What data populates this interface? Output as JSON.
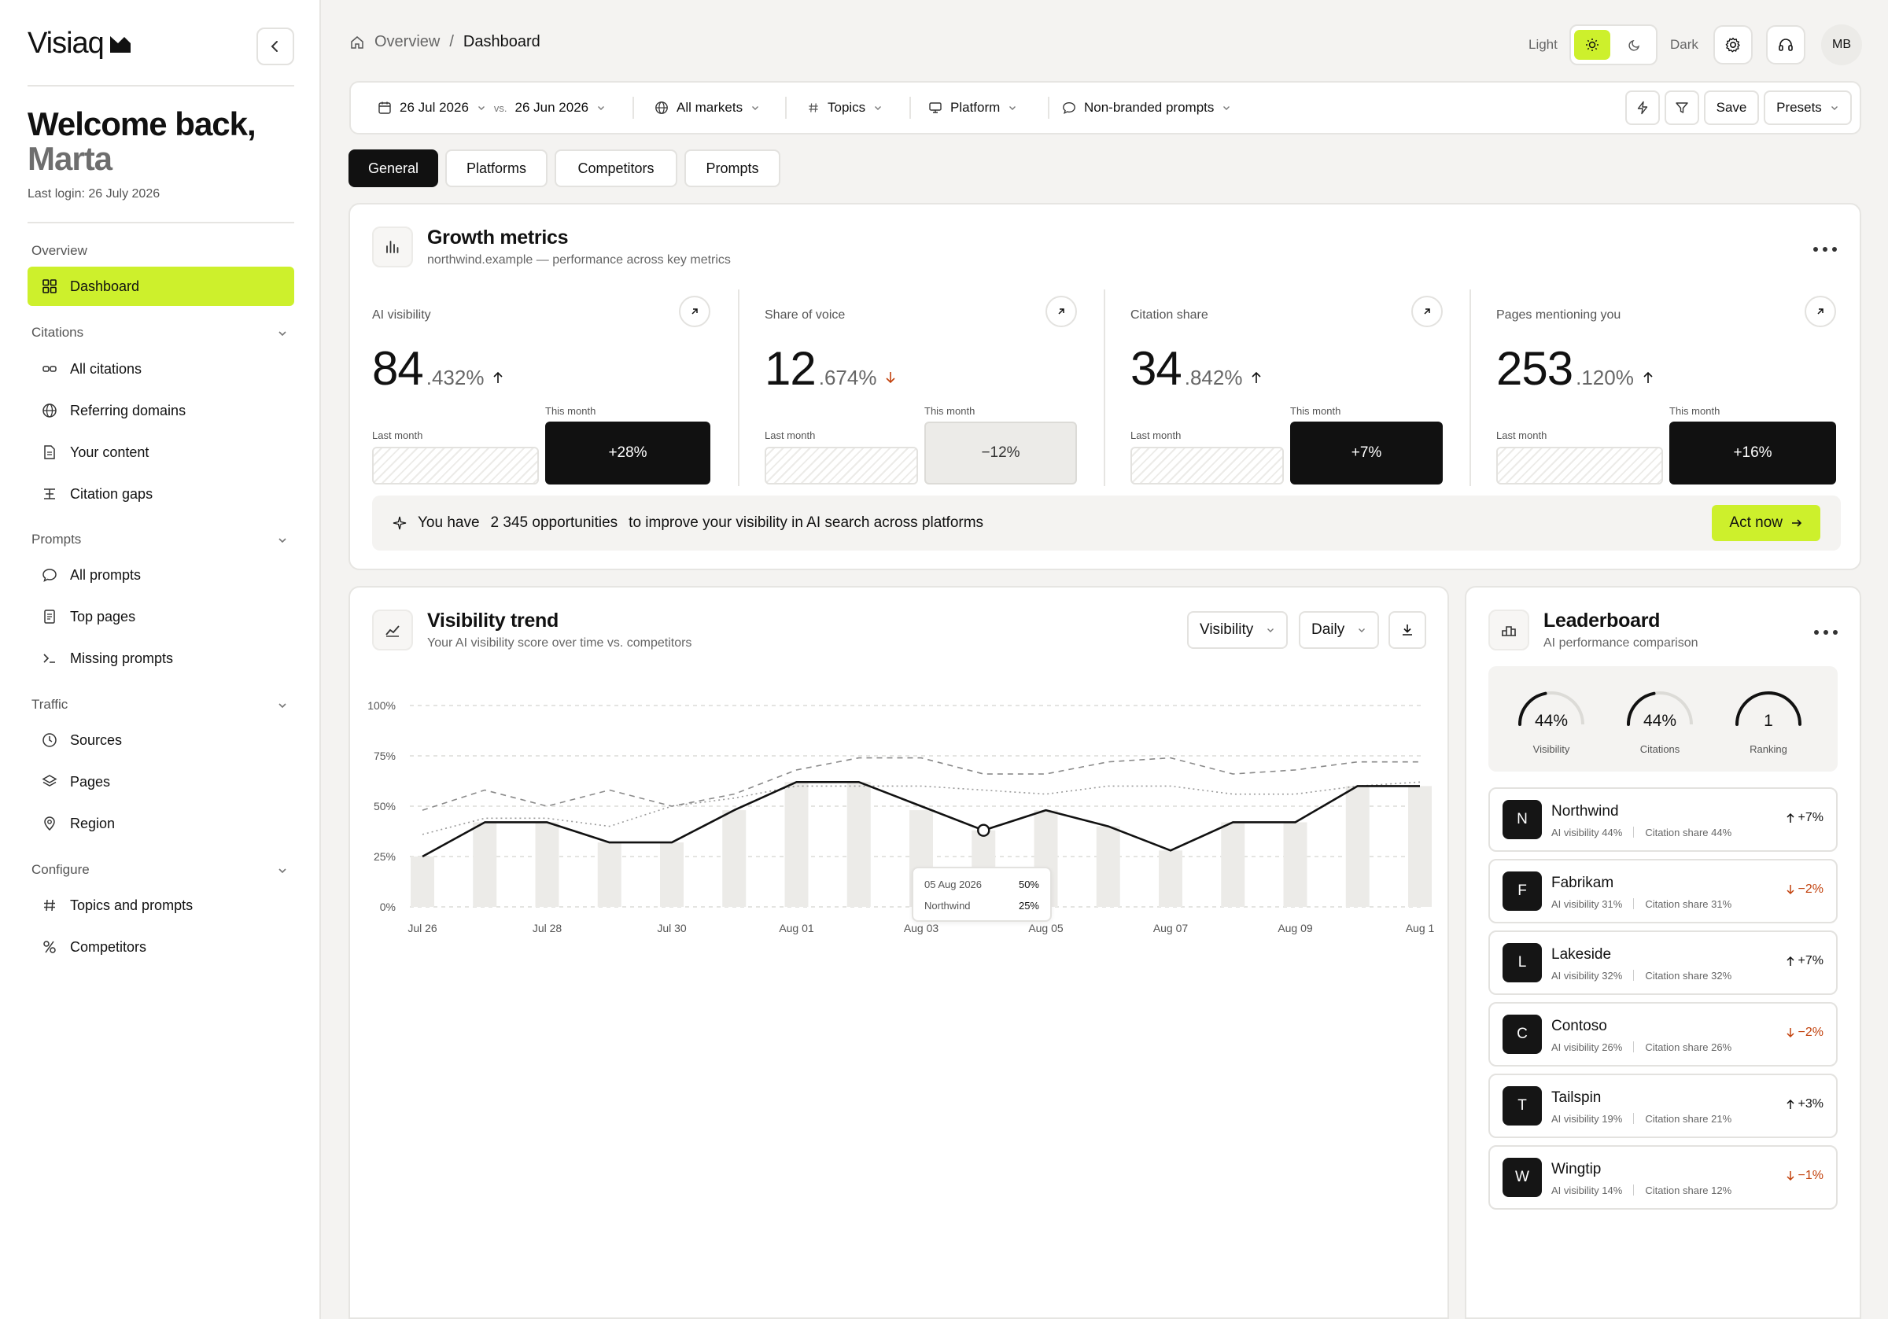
{
  "app": {
    "name": "Visiaq"
  },
  "sidebar": {
    "welcome_line1": "Welcome back,",
    "welcome_name": "Marta",
    "last_login": "Last login: 26 July 2026",
    "sections": [
      {
        "label": "Overview",
        "items": [
          {
            "label": "Dashboard",
            "icon": "grid-icon",
            "active": true
          }
        ]
      },
      {
        "label": "Citations",
        "items": [
          {
            "label": "All citations",
            "icon": "link-icon"
          },
          {
            "label": "Referring domains",
            "icon": "globe-icon"
          },
          {
            "label": "Your content",
            "icon": "document-icon"
          },
          {
            "label": "Citation gaps",
            "icon": "gap-icon"
          }
        ]
      },
      {
        "label": "Prompts",
        "items": [
          {
            "label": "All prompts",
            "icon": "chat-icon"
          },
          {
            "label": "Top pages",
            "icon": "file-icon"
          },
          {
            "label": "Missing prompts",
            "icon": "terminal-icon"
          }
        ]
      },
      {
        "label": "Traffic",
        "items": [
          {
            "label": "Sources",
            "icon": "clock-icon"
          },
          {
            "label": "Pages",
            "icon": "layers-icon"
          },
          {
            "label": "Region",
            "icon": "pin-icon"
          }
        ]
      },
      {
        "label": "Configure",
        "items": [
          {
            "label": "Topics and prompts",
            "icon": "hash-icon"
          },
          {
            "label": "Competitors",
            "icon": "competitors-icon"
          }
        ]
      }
    ]
  },
  "header": {
    "breadcrumb_root": "Overview",
    "breadcrumb_sep": "/",
    "breadcrumb_current": "Dashboard",
    "theme_light": "Light",
    "theme_dark": "Dark",
    "avatar_initials": "MB"
  },
  "filters": {
    "date_from": "26 Jul 2026",
    "vs": "vs.",
    "date_to": "26 Jun 2026",
    "markets": "All markets",
    "topics": "Topics",
    "platform": "Platform",
    "prompts": "Non-branded prompts",
    "save": "Save",
    "presets": "Presets"
  },
  "tabs": [
    "General",
    "Platforms",
    "Competitors",
    "Prompts"
  ],
  "growth": {
    "title": "Growth metrics",
    "subtitle": "northwind.example — performance across key metrics",
    "last_month_label": "Last month",
    "this_month_label": "This month",
    "metrics": [
      {
        "label": "AI visibility",
        "value": "84",
        "decimal": ".432%",
        "trend": "up",
        "this_month": "+28%",
        "style": "dark"
      },
      {
        "label": "Share of voice",
        "value": "12",
        "decimal": ".674%",
        "trend": "down",
        "this_month": "−12%",
        "style": "light"
      },
      {
        "label": "Citation share",
        "value": "34",
        "decimal": ".842%",
        "trend": "up",
        "this_month": "+7%",
        "style": "dark"
      },
      {
        "label": "Pages mentioning you",
        "value": "253",
        "decimal": ".120%",
        "trend": "up",
        "this_month": "+16%",
        "style": "dark"
      }
    ],
    "opportunity_pre": "You have",
    "opportunity_count": "2 345 opportunities",
    "opportunity_post": "to improve your visibility in AI search across platforms",
    "act_now": "Act now"
  },
  "trend": {
    "title": "Visibility trend",
    "subtitle": "Your AI visibility score over time vs. competitors",
    "metric_select": "Visibility",
    "period_select": "Daily",
    "tooltip": {
      "date": "05 Aug 2026",
      "date_value": "50%",
      "series": "Northwind",
      "series_value": "25%"
    }
  },
  "chart_data": {
    "type": "line",
    "x": [
      "Jul 26",
      "Jul 27",
      "Jul 28",
      "Jul 29",
      "Jul 30",
      "Jul 31",
      "Aug 01",
      "Aug 02",
      "Aug 03",
      "Aug 04",
      "Aug 05",
      "Aug 06",
      "Aug 07",
      "Aug 08",
      "Aug 09",
      "Aug 10",
      "Aug 11"
    ],
    "x_tick_labels": [
      "Jul 26",
      "Jul 28",
      "Jul 30",
      "Aug 01",
      "Aug 03",
      "Aug 05",
      "Aug 07",
      "Aug 09",
      "Aug 1"
    ],
    "y_tick_labels": [
      "100%",
      "75%",
      "50%",
      "25%",
      "0%"
    ],
    "ylim": [
      0,
      100
    ],
    "grid": true,
    "bars": [
      25,
      42,
      42,
      32,
      32,
      48,
      62,
      62,
      48,
      38,
      48,
      40,
      28,
      42,
      42,
      60,
      60
    ],
    "series": [
      {
        "values": [
          25,
          42,
          42,
          32,
          32,
          48,
          62,
          62,
          50,
          38,
          48,
          40,
          28,
          42,
          42,
          60,
          60
        ],
        "style": "solid"
      },
      {
        "values": [
          48,
          58,
          50,
          58,
          50,
          56,
          68,
          74,
          74,
          66,
          66,
          72,
          74,
          66,
          68,
          72,
          72
        ],
        "style": "dashed"
      },
      {
        "values": [
          36,
          44,
          44,
          40,
          50,
          54,
          60,
          60,
          60,
          58,
          56,
          60,
          60,
          56,
          56,
          60,
          62
        ],
        "style": "dotted"
      }
    ]
  },
  "leaderboard": {
    "title": "Leaderboard",
    "subtitle": "AI performance comparison",
    "gauges": [
      {
        "value": "44%",
        "label": "Visibility",
        "fraction": 0.44
      },
      {
        "value": "44%",
        "label": "Citations",
        "fraction": 0.44
      },
      {
        "value": "1",
        "label": "Ranking",
        "fraction": 1.0
      }
    ],
    "rows": [
      {
        "initial": "N",
        "name": "Northwind",
        "visibility": "AI visibility 44%",
        "citation": "Citation share 44%",
        "delta": "+7%",
        "dir": "up"
      },
      {
        "initial": "F",
        "name": "Fabrikam",
        "visibility": "AI visibility 31%",
        "citation": "Citation share 31%",
        "delta": "−2%",
        "dir": "down"
      },
      {
        "initial": "L",
        "name": "Lakeside",
        "visibility": "AI visibility 32%",
        "citation": "Citation share 32%",
        "delta": "+7%",
        "dir": "up"
      },
      {
        "initial": "C",
        "name": "Contoso",
        "visibility": "AI visibility 26%",
        "citation": "Citation share 26%",
        "delta": "−2%",
        "dir": "down"
      },
      {
        "initial": "T",
        "name": "Tailspin",
        "visibility": "AI visibility 19%",
        "citation": "Citation share 21%",
        "delta": "+3%",
        "dir": "up"
      },
      {
        "initial": "W",
        "name": "Wingtip",
        "visibility": "AI visibility 14%",
        "citation": "Citation share 12%",
        "delta": "−1%",
        "dir": "down"
      }
    ]
  },
  "colors": {
    "accent": "#cdf02c",
    "dark": "#111111",
    "negative": "#c2410c",
    "background": "#f4f3f1"
  }
}
